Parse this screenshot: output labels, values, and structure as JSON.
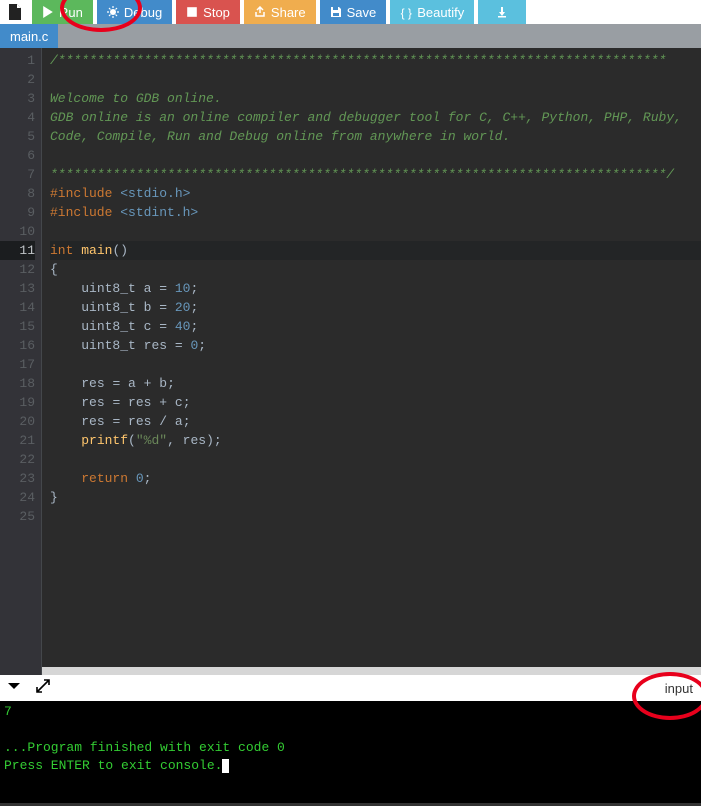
{
  "toolbar": {
    "run": "Run",
    "debug": "Debug",
    "stop": "Stop",
    "share": "Share",
    "save": "Save",
    "beautify": "Beautify"
  },
  "tab": {
    "name": "main.c"
  },
  "code": {
    "lines": [
      {
        "n": 1,
        "type": "comment",
        "text": "/******************************************************************************"
      },
      {
        "n": 2,
        "type": "blank",
        "text": ""
      },
      {
        "n": 3,
        "type": "comment",
        "text": "Welcome to GDB online."
      },
      {
        "n": 4,
        "type": "comment",
        "text": "GDB online is an online compiler and debugger tool for C, C++, Python, PHP, Ruby,"
      },
      {
        "n": 5,
        "type": "comment",
        "text": "Code, Compile, Run and Debug online from anywhere in world."
      },
      {
        "n": 6,
        "type": "blank",
        "text": ""
      },
      {
        "n": 7,
        "type": "comment",
        "text": "*******************************************************************************/"
      },
      {
        "n": 8,
        "type": "include",
        "header": "<stdio.h>"
      },
      {
        "n": 9,
        "type": "include",
        "header": "<stdint.h>"
      },
      {
        "n": 10,
        "type": "blank",
        "text": ""
      },
      {
        "n": 11,
        "type": "sig",
        "kw": "int",
        "fn": "main",
        "rest": "()"
      },
      {
        "n": 12,
        "type": "raw",
        "text": "{"
      },
      {
        "n": 13,
        "type": "decl",
        "t": "uint8_t",
        "name": "a",
        "val": "10"
      },
      {
        "n": 14,
        "type": "decl",
        "t": "uint8_t",
        "name": "b",
        "val": "20"
      },
      {
        "n": 15,
        "type": "decl",
        "t": "uint8_t",
        "name": "c",
        "val": "40"
      },
      {
        "n": 16,
        "type": "decl",
        "t": "uint8_t",
        "name": "res",
        "val": "0"
      },
      {
        "n": 17,
        "type": "blank",
        "text": ""
      },
      {
        "n": 18,
        "type": "assign",
        "lhs": "res",
        "a": "a",
        "op": "+",
        "b": "b"
      },
      {
        "n": 19,
        "type": "assign",
        "lhs": "res",
        "a": "res",
        "op": "+",
        "b": "c"
      },
      {
        "n": 20,
        "type": "assign",
        "lhs": "res",
        "a": "res",
        "op": "/",
        "b": "a"
      },
      {
        "n": 21,
        "type": "printf",
        "fmt": "\"%d\"",
        "arg": "res"
      },
      {
        "n": 22,
        "type": "blank",
        "text": ""
      },
      {
        "n": 23,
        "type": "return",
        "val": "0"
      },
      {
        "n": 24,
        "type": "raw",
        "text": "}"
      },
      {
        "n": 25,
        "type": "blank",
        "text": ""
      }
    ],
    "active_line": 11
  },
  "console": {
    "label": "input",
    "output_value": "7",
    "finished": "...Program finished with exit code 0",
    "prompt": "Press ENTER to exit console."
  }
}
